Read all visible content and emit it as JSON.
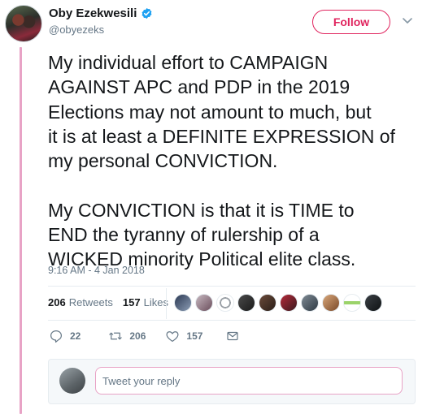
{
  "author": {
    "display_name": "Oby Ezekwesili",
    "handle": "@obyezeks",
    "verified": true,
    "avatar_icon": "profile-photo"
  },
  "follow_button": {
    "label": "Follow"
  },
  "menu_icon": "chevron-down-icon",
  "tweet": {
    "text": "My individual effort to CAMPAIGN\nAGAINST APC and PDP in the 2019\nElections may not amount to much, but\nit is at least a DEFINITE EXPRESSION of\nmy personal CONVICTION.\n\nMy CONVICTION is that it is TIME to\nEND the tyranny of rulership of a\nWICKED minority Political elite class.",
    "timestamp": "9:16 AM - 4 Jan 2018"
  },
  "stats": {
    "retweets_count": "206",
    "retweets_label": "Retweets",
    "likes_count": "157",
    "likes_label": "Likes"
  },
  "likers": [
    "liker-avatar-1",
    "liker-avatar-2",
    "liker-avatar-3",
    "liker-avatar-4",
    "liker-avatar-5",
    "liker-avatar-6",
    "liker-avatar-7",
    "liker-avatar-8",
    "liker-avatar-9",
    "liker-avatar-10"
  ],
  "actions": {
    "reply_count": "22",
    "retweet_count": "206",
    "like_count": "157"
  },
  "reply": {
    "placeholder": "Tweet your reply"
  },
  "colors": {
    "accent": "#e0245e",
    "thread_bar": "#e8a3c6",
    "verified": "#1da1f2",
    "muted": "#657786",
    "divider": "#e6ecf0"
  }
}
